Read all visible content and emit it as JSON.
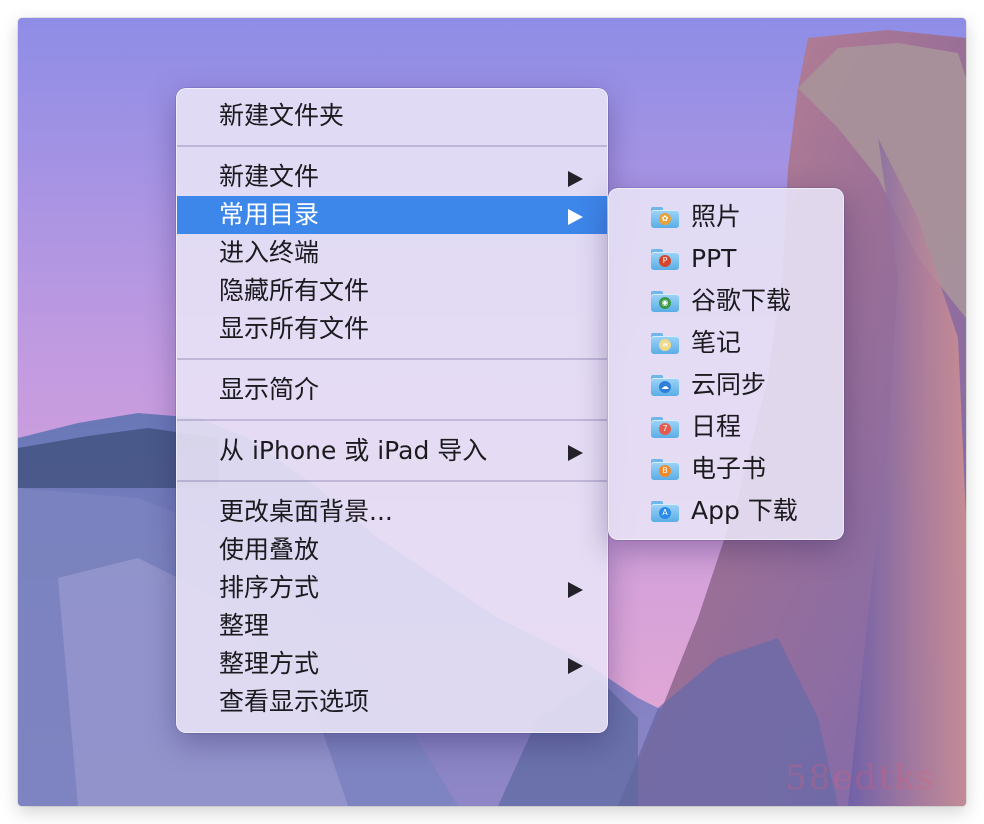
{
  "main_menu": {
    "items": [
      {
        "label": "新建文件夹",
        "submenu": false
      },
      {
        "separator": true
      },
      {
        "label": "新建文件",
        "submenu": true
      },
      {
        "label": "常用目录",
        "submenu": true,
        "active": true
      },
      {
        "label": "进入终端",
        "submenu": false
      },
      {
        "label": "隐藏所有文件",
        "submenu": false
      },
      {
        "label": "显示所有文件",
        "submenu": false
      },
      {
        "separator": true
      },
      {
        "label": "显示简介",
        "submenu": false
      },
      {
        "separator": true
      },
      {
        "label": "从 iPhone 或 iPad 导入",
        "submenu": true
      },
      {
        "separator": true
      },
      {
        "label": "更改桌面背景...",
        "submenu": false
      },
      {
        "label": "使用叠放",
        "submenu": false
      },
      {
        "label": "排序方式",
        "submenu": true
      },
      {
        "label": "整理",
        "submenu": false
      },
      {
        "label": "整理方式",
        "submenu": true
      },
      {
        "label": "查看显示选项",
        "submenu": false
      }
    ]
  },
  "sub_menu": {
    "items": [
      {
        "label": "照片",
        "icon": "photos-folder-icon",
        "badge_color": "#e8a23a",
        "badge_glyph": "✿"
      },
      {
        "label": "PPT",
        "icon": "powerpoint-folder-icon",
        "badge_color": "#d5452b",
        "badge_glyph": "P"
      },
      {
        "label": "谷歌下载",
        "icon": "chrome-folder-icon",
        "badge_color": "#3c9a4a",
        "badge_glyph": "◉"
      },
      {
        "label": "笔记",
        "icon": "notes-folder-icon",
        "badge_color": "#f0d98a",
        "badge_glyph": "≡"
      },
      {
        "label": "云同步",
        "icon": "cloud-folder-icon",
        "badge_color": "#2f7fd8",
        "badge_glyph": "☁"
      },
      {
        "label": "日程",
        "icon": "calendar-folder-icon",
        "badge_color": "#e45a4c",
        "badge_glyph": "7"
      },
      {
        "label": "电子书",
        "icon": "books-folder-icon",
        "badge_color": "#f08a2c",
        "badge_glyph": "B"
      },
      {
        "label": "App 下载",
        "icon": "appstore-folder-icon",
        "badge_color": "#2a8bea",
        "badge_glyph": "A"
      }
    ]
  },
  "watermark": "58edtks",
  "colors": {
    "highlight": "#3d86ea"
  }
}
